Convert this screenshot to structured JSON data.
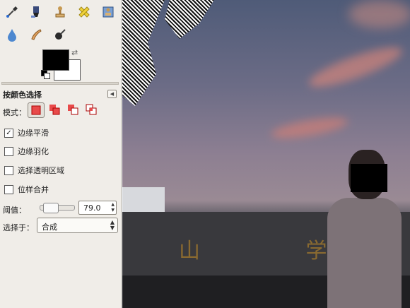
{
  "tools": {
    "row1": [
      "color-picker-icon",
      "ink-icon",
      "clone-stamp-icon",
      "heal-icon",
      "perspective-clone-icon"
    ],
    "row2": [
      "blur-icon",
      "smudge-icon",
      "dodge-burn-icon"
    ]
  },
  "colors": {
    "foreground": "#000000",
    "background": "#ffffff"
  },
  "options": {
    "title": "按颜色选择",
    "mode_label": "模式：",
    "antialias": {
      "label": "边缘平滑",
      "checked": true
    },
    "feather": {
      "label": "边缘羽化",
      "checked": false
    },
    "select_transparent": {
      "label": "选择透明区域",
      "checked": false
    },
    "sample_merged": {
      "label": "位样合并",
      "checked": false
    },
    "threshold_label": "阈值：",
    "threshold_value": "79.0",
    "select_by_label": "选择于：",
    "select_by_value": "合成"
  },
  "canvas": {
    "sign_text": "山 学"
  }
}
